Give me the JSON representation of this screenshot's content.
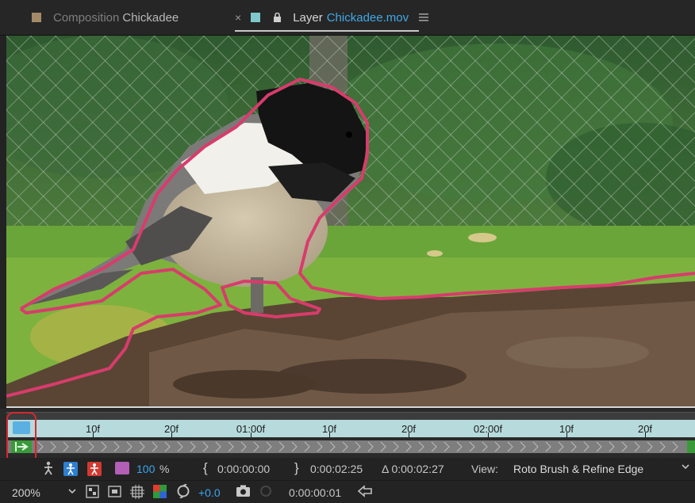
{
  "tabs": {
    "composition": {
      "prefix": "Composition",
      "name": "Chickadee"
    },
    "layer": {
      "prefix": "Layer",
      "name": "Chickadee.mov"
    },
    "close_glyph": "×",
    "menu_icon": "hamburger-menu-icon"
  },
  "viewer": {
    "content": "chickadee-video-frame",
    "segmentation_color": "#d83c6c"
  },
  "timeline": {
    "tick_labels": [
      "10f",
      "20f",
      "01:00f",
      "10f",
      "20f",
      "02:00f",
      "10f",
      "20f"
    ],
    "ruler_color": "#b7dadd",
    "range_color": "#3a9a3a"
  },
  "toolbar1": {
    "opacity_value": "100",
    "opacity_unit": "%",
    "in_point": "0:00:00:00",
    "out_point": "0:00:02:25",
    "duration": "Δ 0:00:02:27",
    "view_label": "View:",
    "view_value": "Roto Brush & Refine Edge"
  },
  "toolbar2": {
    "zoom": "200%",
    "exposure": "+0.0",
    "current_time": "0:00:00:01"
  },
  "colors": {
    "accent_blue": "#3aa4f0",
    "highlight_red": "#d7282f"
  }
}
